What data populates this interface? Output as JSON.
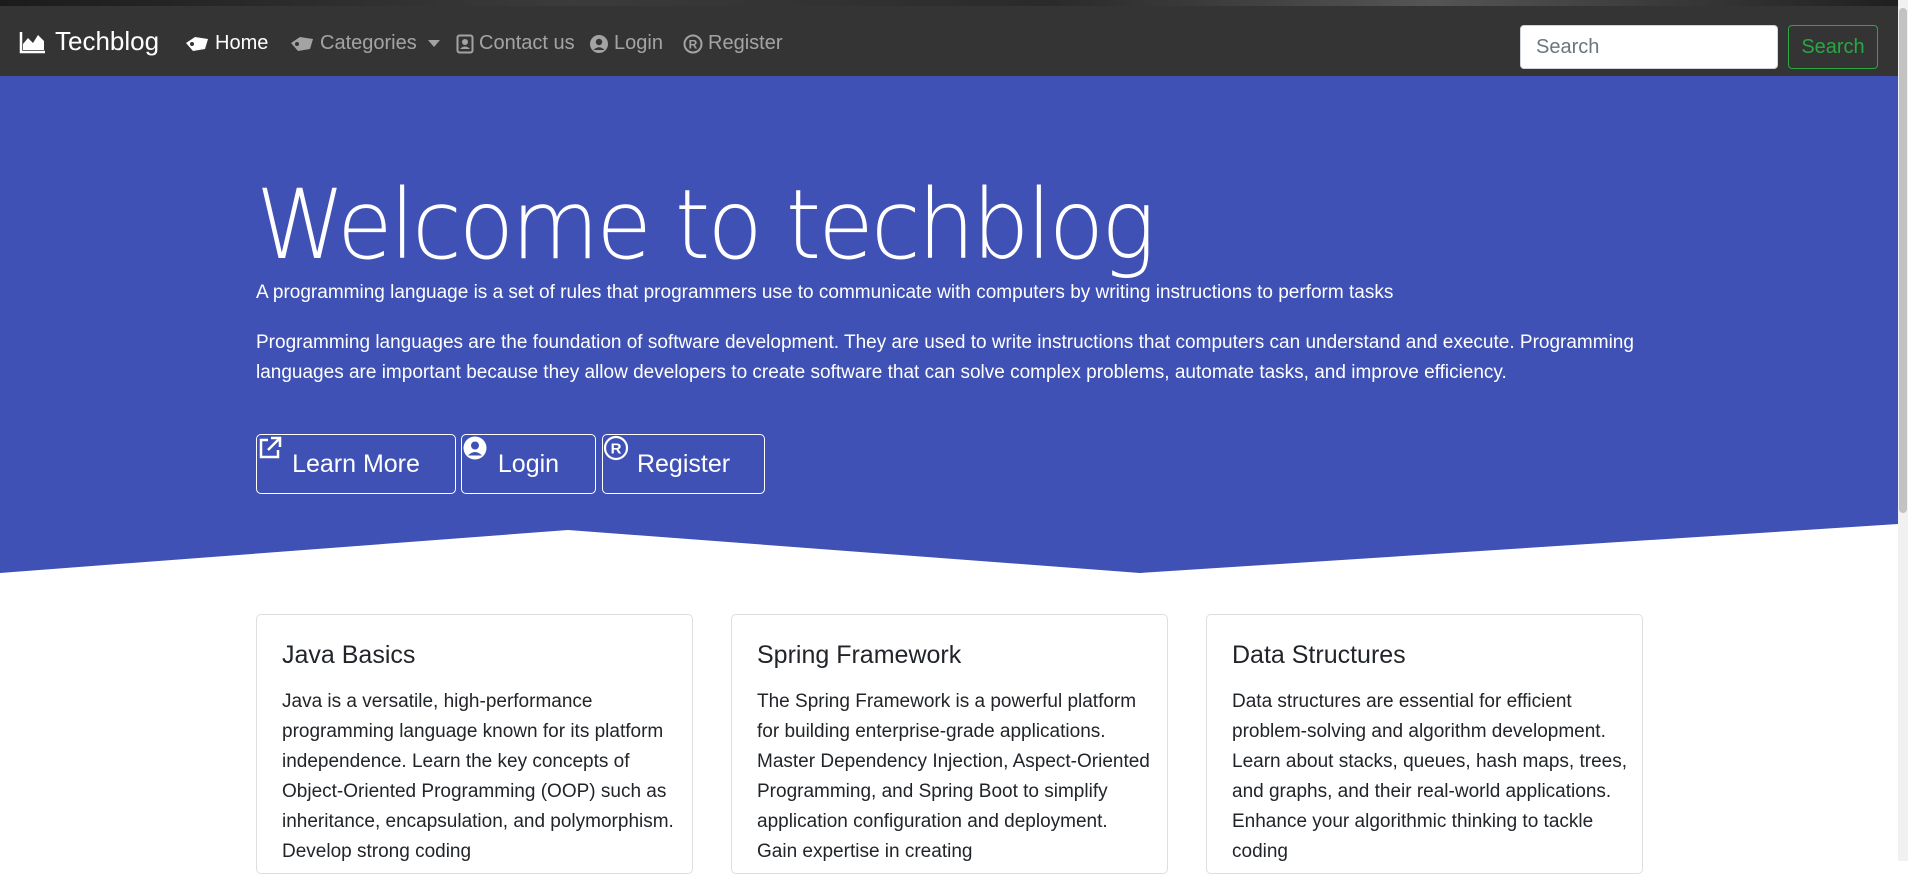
{
  "navbar": {
    "brand": "Techblog",
    "items": [
      {
        "label": "Home",
        "icon": "tag-icon",
        "active": true
      },
      {
        "label": "Categories",
        "icon": "tag-icon",
        "dropdown": true
      },
      {
        "label": "Contact us",
        "icon": "contact-icon"
      },
      {
        "label": "Login",
        "icon": "user-circle-icon"
      },
      {
        "label": "Register",
        "icon": "registered-icon"
      }
    ],
    "search_placeholder": "Search",
    "search_button": "Search"
  },
  "hero": {
    "title": "Welcome to techblog",
    "lead": "A programming language is a set of rules that programmers use to communicate with computers by writing instructions to perform tasks",
    "paragraph": "Programming languages are the foundation of software development. They are used to write instructions that computers can understand and execute. Programming languages are important because they allow developers to create software that can solve complex problems, automate tasks, and improve efficiency.",
    "buttons": [
      {
        "label": "Learn More",
        "icon": "external-link-icon"
      },
      {
        "label": "Login",
        "icon": "user-circle-icon"
      },
      {
        "label": "Register",
        "icon": "registered-icon"
      }
    ]
  },
  "cards": [
    {
      "title": "Java Basics",
      "text": "Java is a versatile, high-performance programming language known for its platform independence. Learn the key concepts of Object-Oriented Programming (OOP) such as inheritance, encapsulation, and polymorphism. Develop strong coding"
    },
    {
      "title": "Spring Framework",
      "text": "The Spring Framework is a powerful platform for building enterprise-grade applications. Master Dependency Injection, Aspect-Oriented Programming, and Spring Boot to simplify application configuration and deployment. Gain expertise in creating"
    },
    {
      "title": "Data Structures",
      "text": "Data structures are essential for efficient problem-solving and algorithm development. Learn about stacks, queues, hash maps, trees, and graphs, and their real-world applications. Enhance your algorithmic thinking to tackle coding"
    }
  ],
  "colors": {
    "navbar": "#343434",
    "hero": "#3f51b5",
    "success": "#28a745"
  }
}
